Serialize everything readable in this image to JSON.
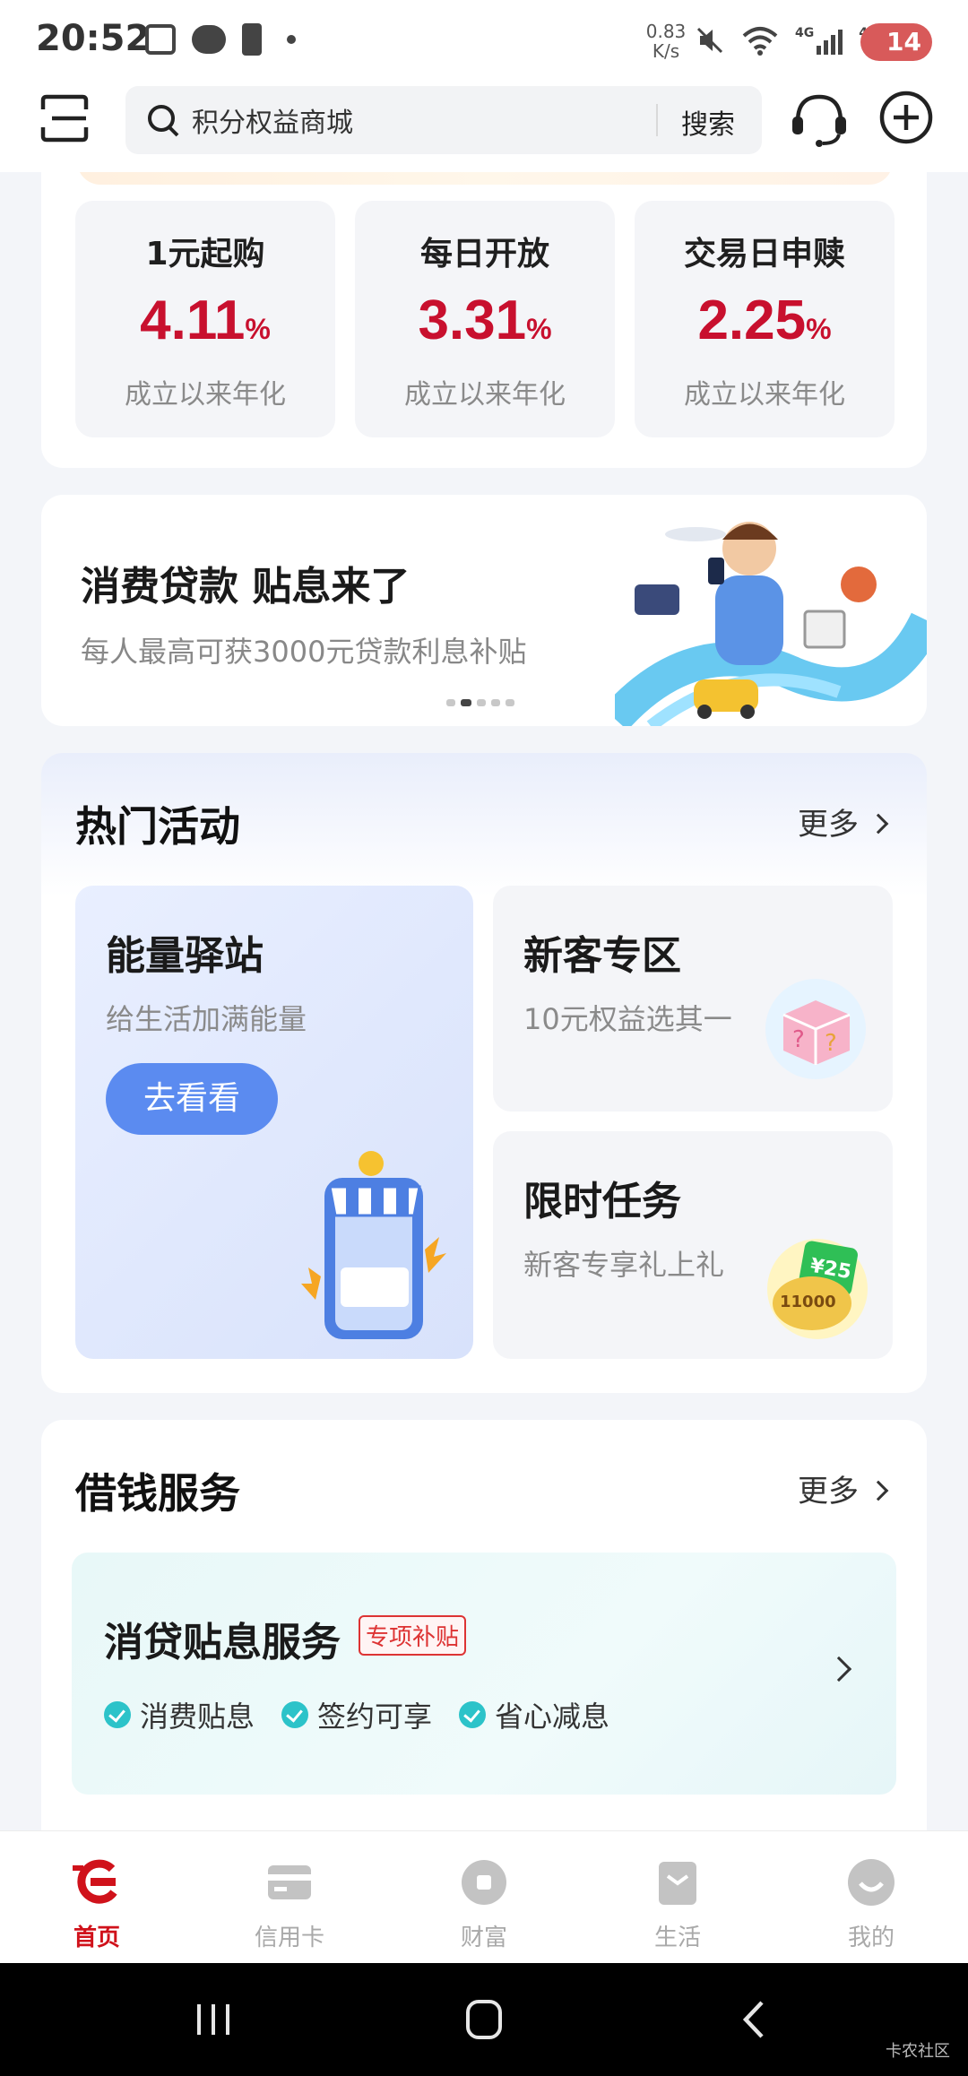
{
  "status_bar": {
    "time": "20:52",
    "net_speed_value": "0.83",
    "net_speed_unit": "K/s",
    "sig1_label": "4G",
    "sig2_label": "4G",
    "battery": "14"
  },
  "header": {
    "search_text": "积分权益商城",
    "search_button": "搜索"
  },
  "funds": [
    {
      "title": "1元起购",
      "rate": "4.11",
      "pct": "%",
      "desc": "成立以来年化"
    },
    {
      "title": "每日开放",
      "rate": "3.31",
      "pct": "%",
      "desc": "成立以来年化"
    },
    {
      "title": "交易日申赎",
      "rate": "2.25",
      "pct": "%",
      "desc": "成立以来年化"
    }
  ],
  "banner": {
    "title": "消费贷款 贴息来了",
    "subtitle": "每人最高可获3000元贷款利息补贴",
    "dots": 5,
    "active_dot": 1
  },
  "hot": {
    "title": "热门活动",
    "more": "更多",
    "left_tile": {
      "title": "能量驿站",
      "sub": "给生活加满能量",
      "button": "去看看"
    },
    "tile1": {
      "title": "新客专区",
      "sub": "10元权益选其一"
    },
    "tile2": {
      "title": "限时任务",
      "sub": "新客专享礼上礼",
      "badge_top": "¥25",
      "badge_bottom": "11000"
    }
  },
  "loan": {
    "title": "借钱服务",
    "more": "更多",
    "card_title": "消贷贴息服务",
    "tag": "专项补贴",
    "features": [
      "消费贴息",
      "签约可享",
      "省心减息"
    ]
  },
  "nav": {
    "items": [
      {
        "label": "首页",
        "active": true
      },
      {
        "label": "信用卡"
      },
      {
        "label": "财富"
      },
      {
        "label": "生活"
      },
      {
        "label": "我的"
      }
    ],
    "active_color": "#d0121b",
    "inactive_color": "#a9a9a9"
  },
  "watermark": "卡农社区"
}
